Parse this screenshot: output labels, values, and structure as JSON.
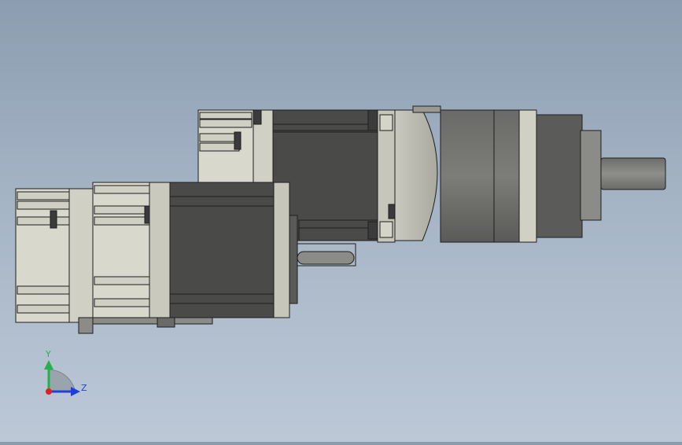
{
  "viewport": {
    "background_top": "#8c9db1",
    "background_bottom": "#bcc8d6"
  },
  "model": {
    "body_color": "#d8d8cc",
    "stator_color": "#4a4b48",
    "gearbox_color": "#6e6e6b",
    "shaft_color": "#7a7b78"
  },
  "triad": {
    "y_label": "Y",
    "z_label": "Z",
    "y_color": "#22b14c",
    "z_color": "#1f3fd8",
    "x_color": "#e02020"
  }
}
